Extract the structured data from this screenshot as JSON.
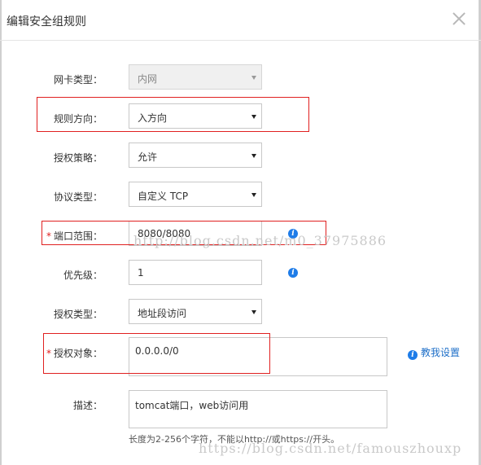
{
  "dialog": {
    "title": "编辑安全组规则",
    "close_icon": "close-icon"
  },
  "form": {
    "nic_type": {
      "label": "网卡类型：",
      "value": "内网",
      "disabled": true
    },
    "direction": {
      "label": "规则方向：",
      "value": "入方向"
    },
    "policy": {
      "label": "授权策略：",
      "value": "允许"
    },
    "protocol": {
      "label": "协议类型：",
      "value": "自定义 TCP"
    },
    "port_range": {
      "label": "端口范围：",
      "required_mark": "*",
      "value": "8080/8080"
    },
    "priority": {
      "label": "优先级：",
      "value": "1"
    },
    "auth_type": {
      "label": "授权类型：",
      "value": "地址段访问"
    },
    "auth_object": {
      "label": "授权对象：",
      "required_mark": "*",
      "value": "0.0.0.0/0"
    },
    "description": {
      "label": "描述：",
      "value": "tomcat端口，web访问用"
    },
    "hint": "长度为2-256个字符，不能以http://或https://开头。",
    "help_link": "教我设置"
  },
  "icons": {
    "info": "i"
  },
  "watermarks": {
    "first": "http://blog.csdn.net/m0_37975886",
    "second": "https://blog.csdn.net/famouszhouxp"
  },
  "colors": {
    "highlight": "#e02020",
    "link": "#1e6fc8",
    "info_icon": "#1e7ce8"
  }
}
